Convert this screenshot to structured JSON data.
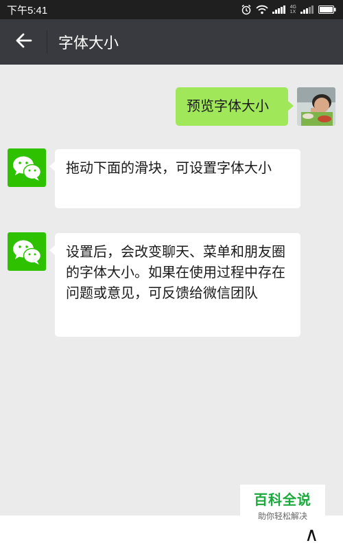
{
  "status_bar": {
    "time": "下午5:41",
    "network_top": "4G",
    "network_bottom": "1X"
  },
  "header": {
    "title": "字体大小",
    "back_icon": "arrow-left-icon"
  },
  "messages": [
    {
      "side": "right",
      "text": "预览字体大小"
    },
    {
      "side": "left",
      "text": "拖动下面的滑块，可设置字体大小"
    },
    {
      "side": "left",
      "text": "设置后，会改变聊天、菜单和朋友圈的字体大小。如果在使用过程中存在问题或意见，可反馈给微信团队"
    }
  ],
  "watermark": {
    "title": "百科全说",
    "subtitle": "助你轻松解决"
  },
  "colors": {
    "header_bg": "#393a3f",
    "chat_bg": "#ebebeb",
    "self_bubble": "#a0e75a",
    "wechat_green": "#2dc100"
  }
}
